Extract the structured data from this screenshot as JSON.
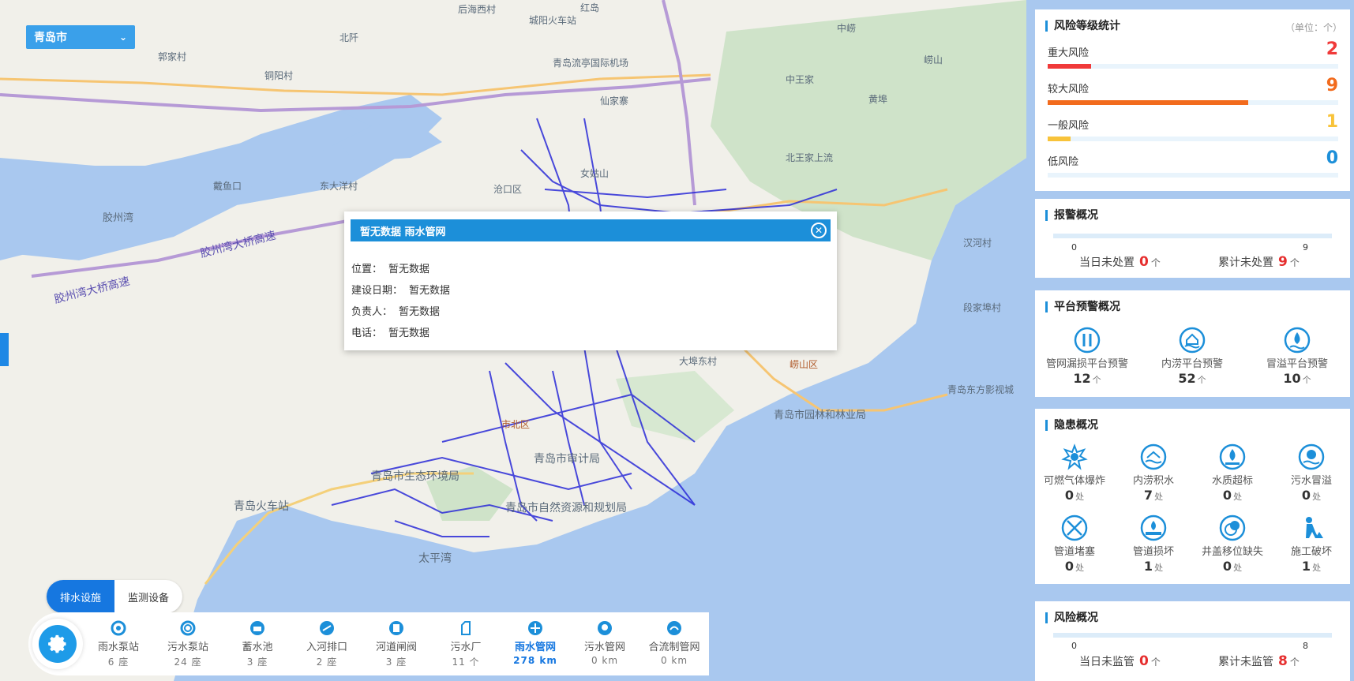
{
  "city_select": {
    "value": "青岛市"
  },
  "map_labels": [
    "后海西村",
    "城阳火车站",
    "红岛",
    "中崂",
    "崂山",
    "郭家村",
    "北阡",
    "铜阳村",
    "中王家",
    "黄埠",
    "仙家寨",
    "女姑山",
    "东大洋村",
    "沧口区",
    "胶州湾大桥高速",
    "胶州湾大桥高速",
    "大埠东村",
    "崂山区",
    "青岛东方影视城",
    "青岛市园林和林业局",
    "市北区",
    "青岛市审计局",
    "青岛市生态环境局",
    "青岛火车站",
    "青岛市自然资源和规划局",
    "太平湾",
    "段家埠村",
    "汉河村",
    "北王家上流",
    "青岛流亭国际机场",
    "胶州湾",
    "戴鱼口"
  ],
  "popup": {
    "title": "暂无数据 雨水管网",
    "rows": [
      {
        "key": "位置：",
        "value": "暂无数据"
      },
      {
        "key": "建设日期：",
        "value": "暂无数据"
      },
      {
        "key": "负责人：",
        "value": "暂无数据"
      },
      {
        "key": "电话：",
        "value": "暂无数据"
      }
    ]
  },
  "bottom_tabs": [
    {
      "label": "排水设施"
    },
    {
      "label": "监测设备"
    }
  ],
  "facilities": [
    {
      "name": "雨水泵站",
      "value": "6 座",
      "icon": "rain-pump-icon"
    },
    {
      "name": "污水泵站",
      "value": "24 座",
      "icon": "sewage-pump-icon"
    },
    {
      "name": "蓄水池",
      "value": "3 座",
      "icon": "reservoir-icon"
    },
    {
      "name": "入河排口",
      "value": "2 座",
      "icon": "river-outlet-icon"
    },
    {
      "name": "河道闸阀",
      "value": "3 座",
      "icon": "river-gate-icon"
    },
    {
      "name": "污水厂",
      "value": "11 个",
      "icon": "sewage-plant-icon"
    },
    {
      "name": "雨水管网",
      "value": "278 km",
      "icon": "rain-network-icon"
    },
    {
      "name": "污水管网",
      "value": "0 km",
      "icon": "sewage-network-icon"
    },
    {
      "name": "合流制管网",
      "value": "0 km",
      "icon": "combined-network-icon"
    }
  ],
  "risk_stats": {
    "title": "风险等级统计",
    "unit": "（单位：个）",
    "items": [
      {
        "name": "重大风险",
        "value": "2",
        "color": "#f03a3a",
        "fraction": 0.15
      },
      {
        "name": "较大风险",
        "value": "9",
        "color": "#f26b1d",
        "fraction": 0.69
      },
      {
        "name": "一般风险",
        "value": "1",
        "color": "#f8c33a",
        "fraction": 0.08
      },
      {
        "name": "低风险",
        "value": "0",
        "color": "#1c8fd9",
        "fraction": 0
      }
    ]
  },
  "alarm": {
    "title": "报警概况",
    "scale_min": "0",
    "scale_max": "9",
    "today_label": "当日未处置",
    "today_value": "0",
    "total_label": "累计未处置",
    "total_value": "9",
    "unit": "个"
  },
  "platform_warning": {
    "title": "平台预警概况",
    "items": [
      {
        "name": "管网漏损平台预警",
        "value": "12",
        "unit": "个",
        "icon": "pipe-leak-icon"
      },
      {
        "name": "内涝平台预警",
        "value": "52",
        "unit": "个",
        "icon": "waterlogging-icon"
      },
      {
        "name": "冒溢平台预警",
        "value": "10",
        "unit": "个",
        "icon": "overflow-icon"
      }
    ]
  },
  "hazards": {
    "title": "隐患概况",
    "items": [
      {
        "name": "可燃气体爆炸",
        "value": "0",
        "unit": "处",
        "icon": "explosion-icon"
      },
      {
        "name": "内涝积水",
        "value": "7",
        "unit": "处",
        "icon": "ponding-icon"
      },
      {
        "name": "水质超标",
        "value": "0",
        "unit": "处",
        "icon": "water-quality-icon"
      },
      {
        "name": "污水冒溢",
        "value": "0",
        "unit": "处",
        "icon": "sewage-overflow-icon"
      },
      {
        "name": "管道堵塞",
        "value": "0",
        "unit": "处",
        "icon": "pipe-blockage-icon"
      },
      {
        "name": "管道损坏",
        "value": "1",
        "unit": "处",
        "icon": "pipe-damage-icon"
      },
      {
        "name": "井盖移位缺失",
        "value": "0",
        "unit": "处",
        "icon": "manhole-cover-icon"
      },
      {
        "name": "施工破坏",
        "value": "1",
        "unit": "处",
        "icon": "construction-icon"
      }
    ]
  },
  "risk_overview": {
    "title": "风险概况",
    "scale_min": "0",
    "scale_max": "8",
    "today_label": "当日未监管",
    "today_value": "0",
    "total_label": "累计未监管",
    "total_value": "8",
    "unit": "个"
  }
}
